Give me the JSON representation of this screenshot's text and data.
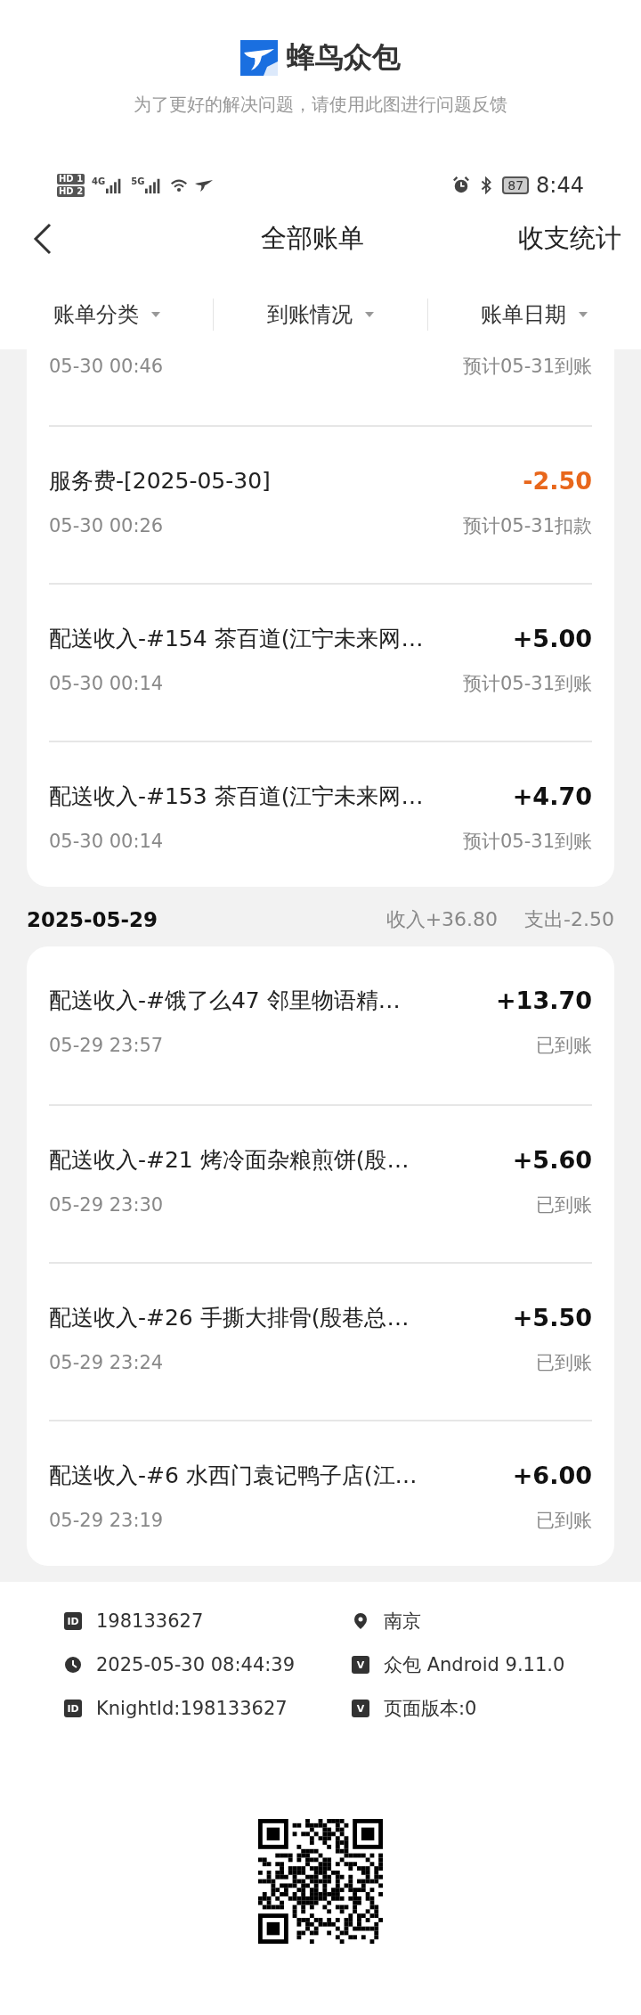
{
  "brand": {
    "name": "蜂鸟众包",
    "subtitle": "为了更好的解决问题，请使用此图进行问题反馈"
  },
  "status_bar": {
    "sims": [
      {
        "badge": "HD",
        "slot": "1"
      },
      {
        "badge": "HD",
        "slot": "2"
      }
    ],
    "networks": [
      "4G",
      "5G"
    ],
    "battery": "87",
    "time": "8:44"
  },
  "nav": {
    "title": "全部账单",
    "action": "收支统计"
  },
  "filters": [
    {
      "label": "账单分类"
    },
    {
      "label": "到账情况"
    },
    {
      "label": "账单日期"
    }
  ],
  "groups": [
    {
      "rows": [
        {
          "time": "05-30 00:46",
          "status": "预计05-31到账"
        },
        {
          "kind": "expense",
          "title": "服务费-[2025-05-30]",
          "amount": "-2.50",
          "time": "05-30 00:26",
          "status": "预计05-31扣款"
        },
        {
          "kind": "income",
          "title": "配送收入-#154 茶百道(江宁未来网…",
          "amount": "+5.00",
          "time": "05-30 00:14",
          "status": "预计05-31到账"
        },
        {
          "kind": "income",
          "title": "配送收入-#153 茶百道(江宁未来网…",
          "amount": "+4.70",
          "time": "05-30 00:14",
          "status": "预计05-31到账"
        }
      ]
    },
    {
      "date": "2025-05-29",
      "income": "收入+36.80",
      "expense": "支出-2.50",
      "rows": [
        {
          "kind": "income",
          "title": "配送收入-#饿了么47 邻里物语精…",
          "amount": "+13.70",
          "time": "05-29 23:57",
          "status": "已到账"
        },
        {
          "kind": "income",
          "title": "配送收入-#21 烤冷面杂粮煎饼(殷…",
          "amount": "+5.60",
          "time": "05-29 23:30",
          "status": "已到账"
        },
        {
          "kind": "income",
          "title": "配送收入-#26 手撕大排骨(殷巷总…",
          "amount": "+5.50",
          "time": "05-29 23:24",
          "status": "已到账"
        },
        {
          "kind": "income",
          "title": "配送收入-#6 水西门袁记鸭子店(江…",
          "amount": "+6.00",
          "time": "05-29 23:19",
          "status": "已到账"
        }
      ]
    }
  ],
  "info": [
    {
      "kind": "badge",
      "badge": "ID",
      "text": "198133627"
    },
    {
      "kind": "pin",
      "text": "南京"
    },
    {
      "kind": "clock",
      "text": "2025-05-30 08:44:39"
    },
    {
      "kind": "badge",
      "badge": "V",
      "text": "众包 Android 9.11.0"
    },
    {
      "kind": "badge",
      "badge": "ID",
      "text": "KnightId:198133627"
    },
    {
      "kind": "badge",
      "badge": "V",
      "text": "页面版本:0"
    }
  ]
}
